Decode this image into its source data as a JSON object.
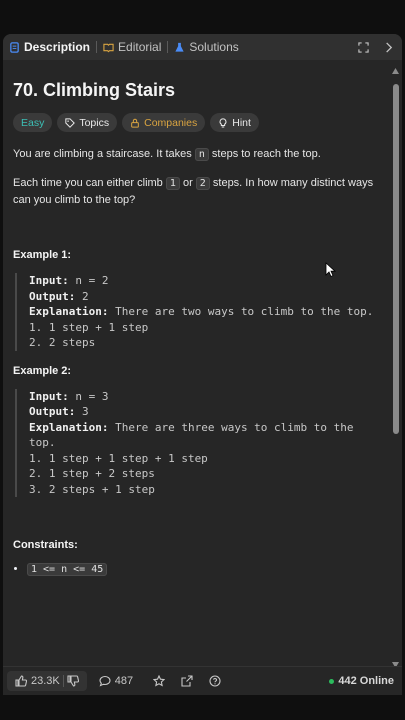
{
  "tabs": [
    {
      "label": "Description",
      "icon": "description-icon"
    },
    {
      "label": "Editorial",
      "icon": "book-icon"
    },
    {
      "label": "Solutions",
      "icon": "flask-icon"
    }
  ],
  "problem": {
    "title": "70. Climbing Stairs",
    "tags": [
      "Easy",
      "Topics",
      "Companies",
      "Hint"
    ],
    "p1_a": "You are climbing a staircase. It takes",
    "p1_code": "n",
    "p1_b": "steps to reach the top.",
    "p2_a": "Each time you can either climb",
    "p2_c1": "1",
    "p2_or": "or",
    "p2_c2": "2",
    "p2_b": "steps. In how many distinct ways can you climb to the top?",
    "example1_heading": "Example 1:",
    "example1": {
      "input_label": "Input:",
      "input": "n = 2",
      "output_label": "Output:",
      "output": "2",
      "expl_label": "Explanation:",
      "expl": "There are two ways to climb to the top.",
      "lines": [
        "1. 1 step + 1 step",
        "2. 2 steps"
      ]
    },
    "example2_heading": "Example 2:",
    "example2": {
      "input_label": "Input:",
      "input": "n = 3",
      "output_label": "Output:",
      "output": "3",
      "expl_label": "Explanation:",
      "expl": "There are three ways to climb to the top.",
      "lines": [
        "1. 1 step + 1 step + 1 step",
        "2. 1 step + 2 steps",
        "3. 2 steps + 1 step"
      ]
    },
    "constraints_heading": "Constraints:",
    "constraint": "1 <= n <= 45"
  },
  "bottom": {
    "likes": "23.3K",
    "comments": "487",
    "online": "442 Online"
  },
  "colors": {
    "easy": "#3cbfb5",
    "companies": "#d9a441",
    "online_dot": "#2cbb5d"
  }
}
